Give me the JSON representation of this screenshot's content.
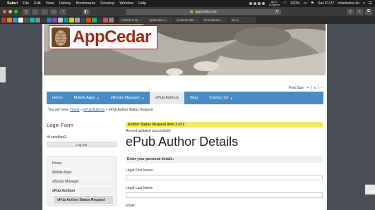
{
  "menubar": {
    "items": [
      "Safari",
      "File",
      "Edit",
      "View",
      "History",
      "Bookmarks",
      "Develop",
      "Window",
      "Help"
    ],
    "status": {
      "temp": "46°C",
      "fan": "1226rpm",
      "battery": "100%",
      "clock": "Sat 21:27",
      "user": "chiemeka ilo"
    }
  },
  "browser": {
    "url": "appcedar.com",
    "tabs": [
      "Failed to op...",
      "AppCedar li...",
      "Amazon We...",
      "Roundcube...",
      "ws li..."
    ]
  },
  "desktop": {
    "right_label": "png"
  },
  "site": {
    "logo_text": "AppCedar",
    "font_size_label": "Font Size:",
    "font_controls": [
      "+",
      "|",
      "x",
      "|",
      "-"
    ],
    "nav": [
      {
        "label": "Home",
        "caret": ""
      },
      {
        "label": "Mobile Apps",
        "caret": "▼"
      },
      {
        "label": "eBooks Manager",
        "caret": "▼"
      },
      {
        "label": "ePub Authors",
        "caret": ""
      },
      {
        "label": "Blog",
        "caret": ""
      },
      {
        "label": "Contact Us",
        "caret": "▼"
      }
    ],
    "breadcrumb": {
      "prefix": "You are here:",
      "home": "Home",
      "sep1": "»",
      "section": "ePub Authors",
      "sep2": "»",
      "current": "ePub Author Status Request"
    }
  },
  "sidebar": {
    "title": "Login Form",
    "greeting": "Hi sandbox2,",
    "logout": "Log out",
    "menu": [
      "Home",
      "Mobile Apps",
      "eBooks Manager",
      "ePub Authors",
      "ePub Author Status Request"
    ]
  },
  "main": {
    "status_bar": "Author Status Request Item 2 of 2",
    "message": "Record updated successfully",
    "title": "ePub Author Details",
    "section": "Enter your personal details:",
    "fields": [
      "Legal First Name:",
      "Legal Last Name:",
      "Email:"
    ]
  },
  "colors": {
    "nav_blue": "#4a8bc5",
    "brand_red": "#9b2a1a",
    "highlight_yellow": "#f4e95a"
  }
}
